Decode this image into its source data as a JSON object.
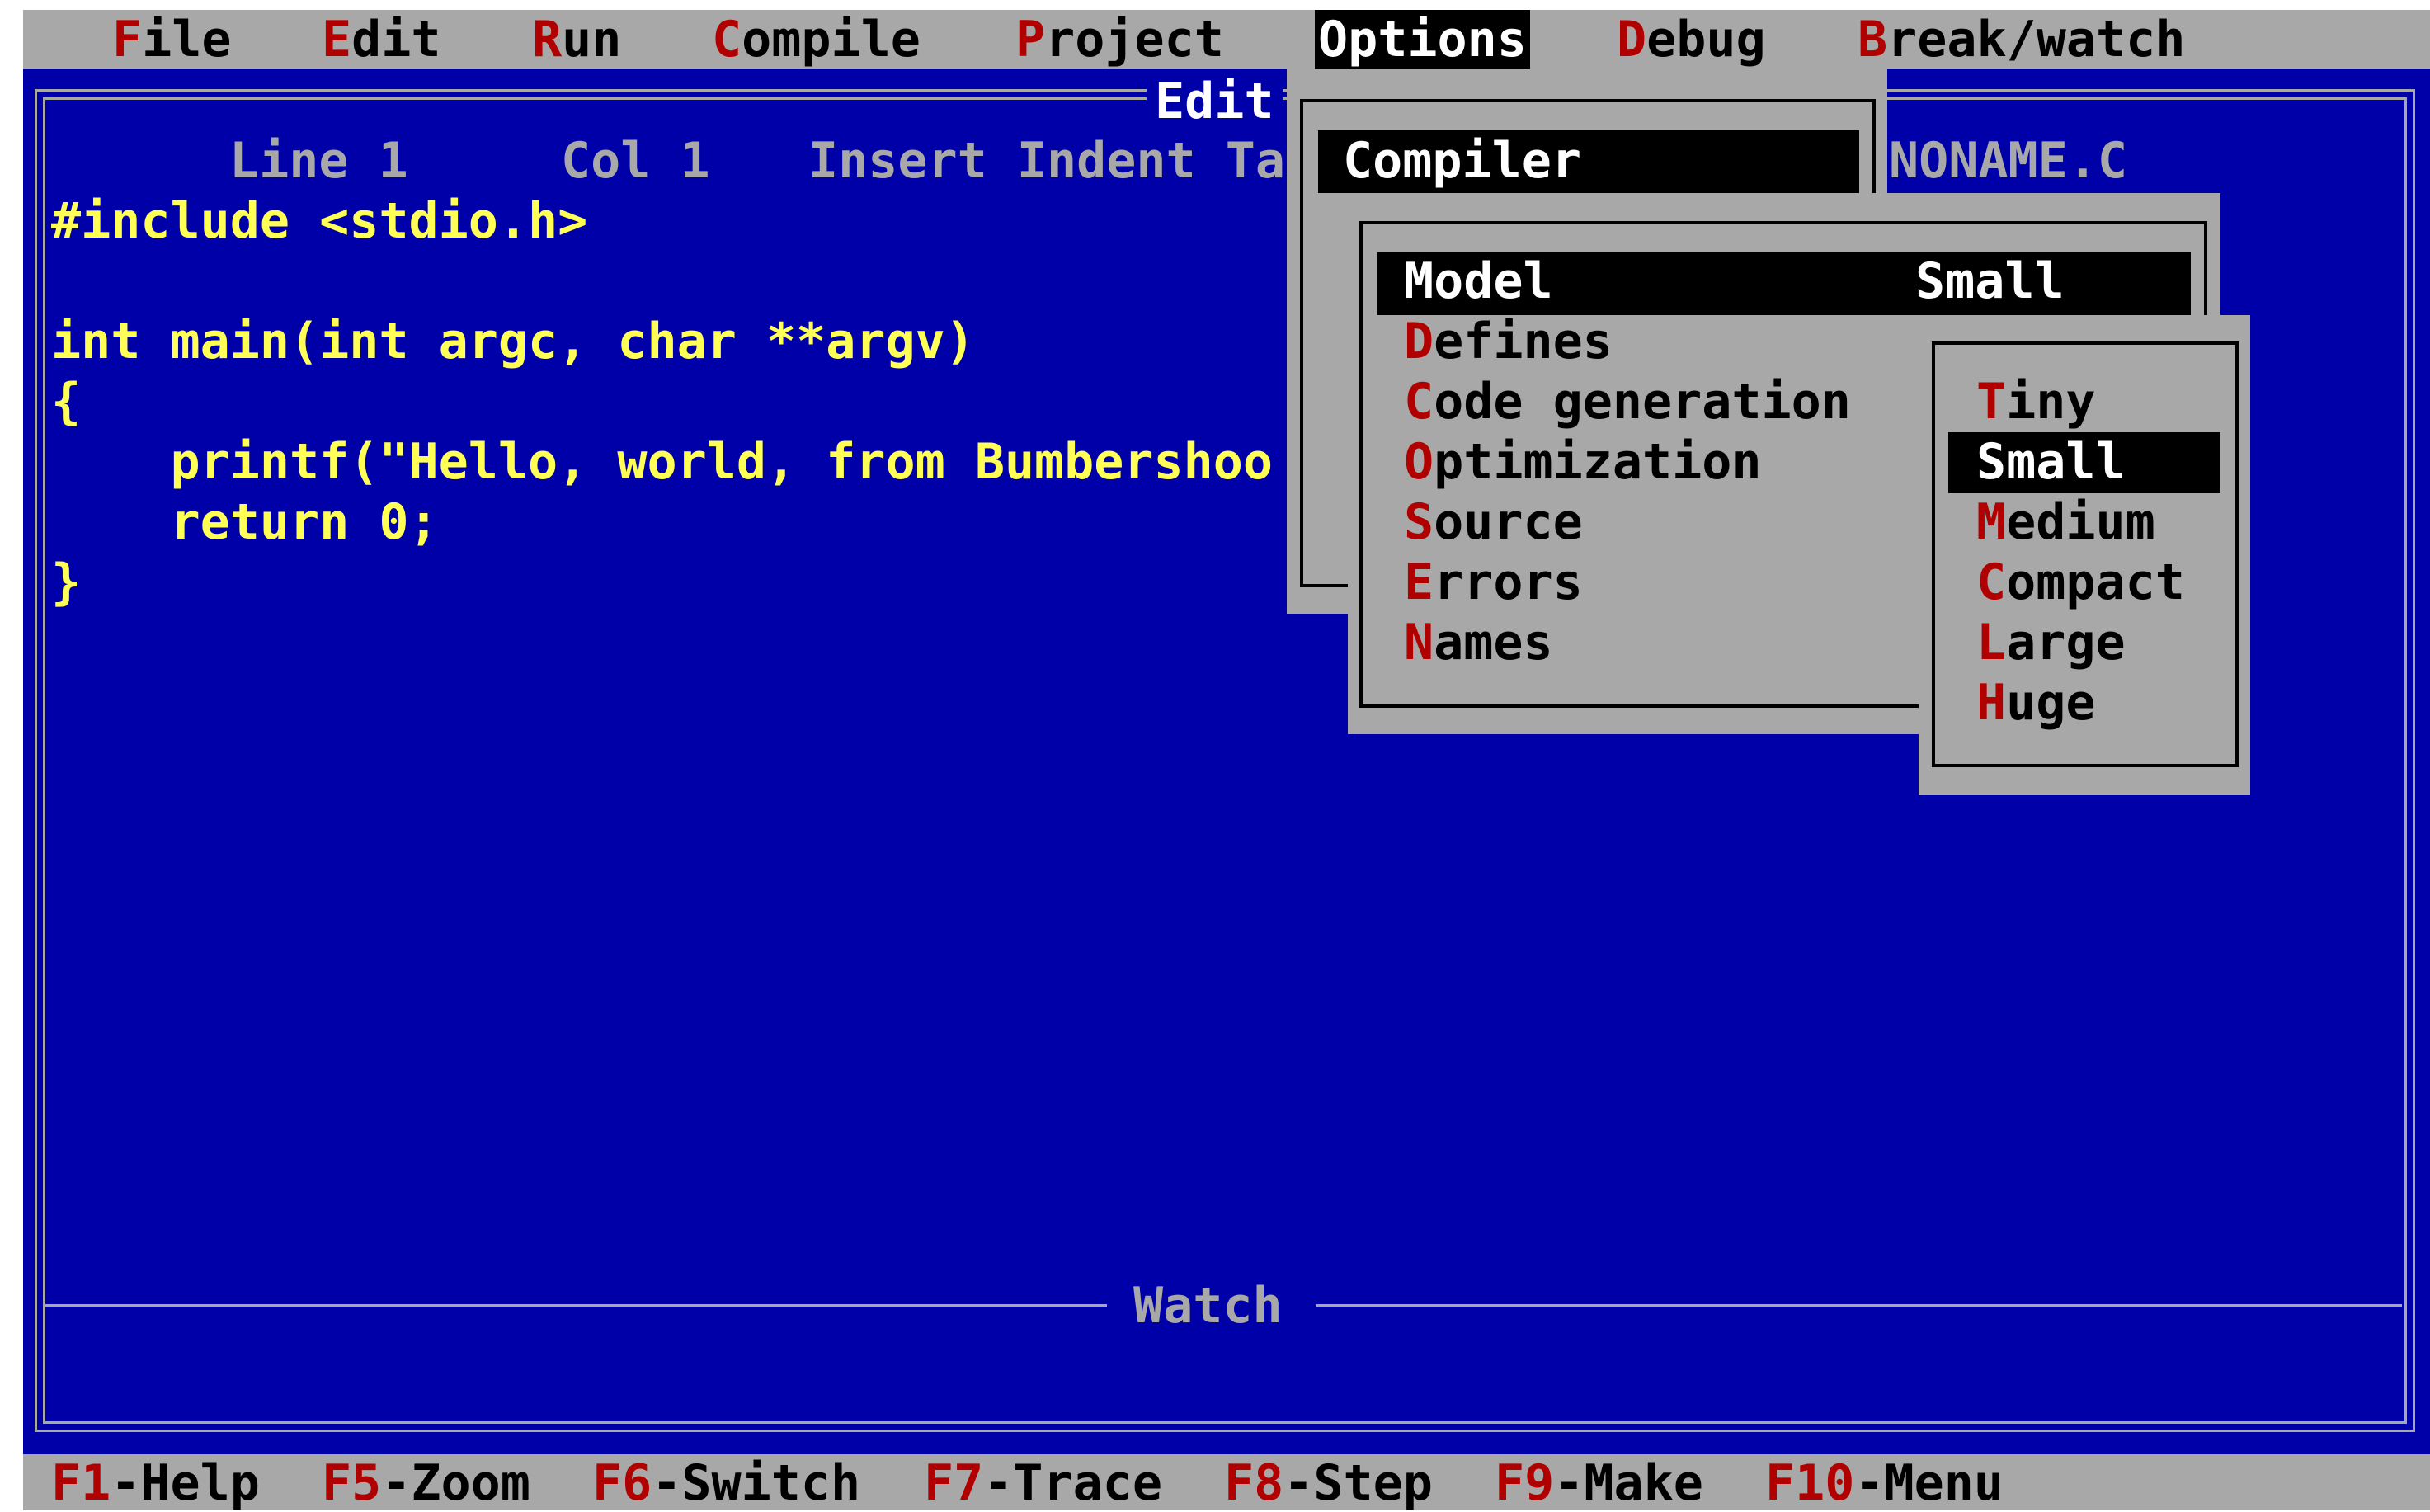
{
  "menubar": {
    "items": [
      {
        "hot": "F",
        "rest": "ile"
      },
      {
        "hot": "E",
        "rest": "dit"
      },
      {
        "hot": "R",
        "rest": "un"
      },
      {
        "hot": "C",
        "rest": "ompile"
      },
      {
        "hot": "P",
        "rest": "roject"
      },
      {
        "hot": "",
        "rest": "Options"
      },
      {
        "hot": "D",
        "rest": "ebug"
      },
      {
        "hot": "B",
        "rest": "reak/watch"
      }
    ]
  },
  "edit_window": {
    "title": "Edit",
    "status": {
      "line": "Line 1",
      "col": "Col 1",
      "mode": "Insert Indent Ta",
      "filename": "NONAME.C"
    },
    "code": [
      "#include <stdio.h>",
      "",
      "int main(int argc, char **argv)",
      "{",
      "    printf(\"Hello, world, from Bumbershoo",
      "    return 0;",
      "}"
    ]
  },
  "watch_window": {
    "title": "Watch"
  },
  "options_menu": {
    "items": [
      {
        "label": "Compiler"
      }
    ]
  },
  "compiler_menu": {
    "items": [
      {
        "hot": "M",
        "rest": "odel",
        "value": "Small"
      },
      {
        "hot": "D",
        "rest": "efines",
        "value": ""
      },
      {
        "hot": "C",
        "rest": "ode generation",
        "value": ""
      },
      {
        "hot": "O",
        "rest": "ptimization",
        "value": ""
      },
      {
        "hot": "S",
        "rest": "ource",
        "value": ""
      },
      {
        "hot": "E",
        "rest": "rrors",
        "value": ""
      },
      {
        "hot": "N",
        "rest": "ames",
        "value": ""
      }
    ]
  },
  "model_menu": {
    "items": [
      {
        "hot": "T",
        "rest": "iny"
      },
      {
        "hot": "S",
        "rest": "mall"
      },
      {
        "hot": "M",
        "rest": "edium"
      },
      {
        "hot": "C",
        "rest": "ompact"
      },
      {
        "hot": "L",
        "rest": "arge"
      },
      {
        "hot": "H",
        "rest": "uge"
      }
    ]
  },
  "statusbar": {
    "keys": [
      {
        "key": "F1",
        "label": "-Help"
      },
      {
        "key": "F5",
        "label": "-Zoom"
      },
      {
        "key": "F6",
        "label": "-Switch"
      },
      {
        "key": "F7",
        "label": "-Trace"
      },
      {
        "key": "F8",
        "label": "-Step"
      },
      {
        "key": "F9",
        "label": "-Make"
      },
      {
        "key": "F10",
        "label": "-Menu"
      }
    ]
  },
  "colors": {
    "screen_bg": "#0000a8",
    "menu_bg": "#a8a8a8",
    "hotkey": "#b00000",
    "code_text": "#ffff55",
    "selection_bg": "#000000"
  }
}
